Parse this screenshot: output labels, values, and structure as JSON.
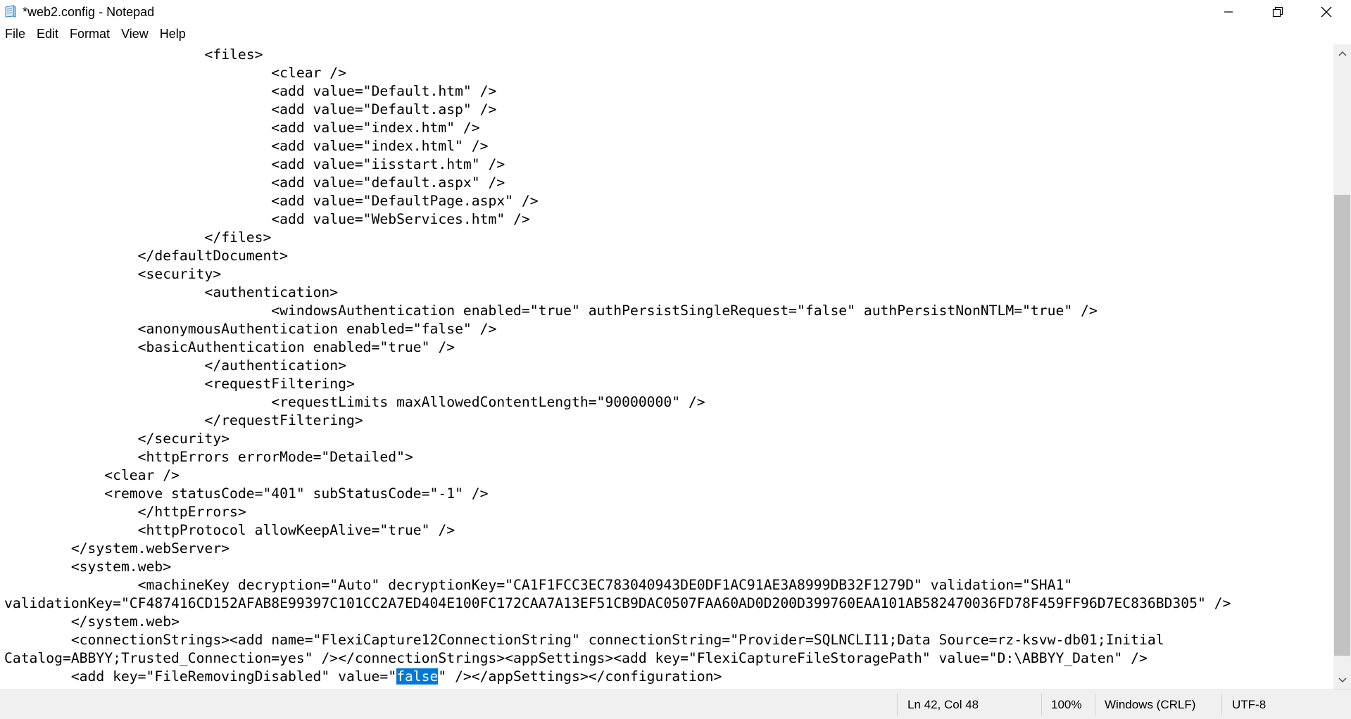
{
  "window": {
    "title": "*web2.config - Notepad"
  },
  "menu": {
    "file": "File",
    "edit": "Edit",
    "format": "Format",
    "view": "View",
    "help": "Help"
  },
  "editor": {
    "lines": [
      "\t\t\t<files>",
      "\t\t\t\t<clear />",
      "\t\t\t\t<add value=\"Default.htm\" />",
      "\t\t\t\t<add value=\"Default.asp\" />",
      "\t\t\t\t<add value=\"index.htm\" />",
      "\t\t\t\t<add value=\"index.html\" />",
      "\t\t\t\t<add value=\"iisstart.htm\" />",
      "\t\t\t\t<add value=\"default.aspx\" />",
      "\t\t\t\t<add value=\"DefaultPage.aspx\" />",
      "\t\t\t\t<add value=\"WebServices.htm\" />",
      "\t\t\t</files>",
      "\t\t</defaultDocument>",
      "\t\t<security>",
      "\t\t\t<authentication>",
      "\t\t\t\t<windowsAuthentication enabled=\"true\" authPersistSingleRequest=\"false\" authPersistNonNTLM=\"true\" />",
      "\t\t<anonymousAuthentication enabled=\"false\" />",
      "\t\t<basicAuthentication enabled=\"true\" />",
      "\t\t\t</authentication>",
      "\t\t\t<requestFiltering>",
      "\t\t\t\t<requestLimits maxAllowedContentLength=\"90000000\" />",
      "\t\t\t</requestFiltering>",
      "\t\t</security>",
      "\t\t<httpErrors errorMode=\"Detailed\">",
      "            <clear />",
      "            <remove statusCode=\"401\" subStatusCode=\"-1\" />",
      "\t\t</httpErrors>",
      "\t\t<httpProtocol allowKeepAlive=\"true\" />",
      "\t</system.webServer>",
      "\t<system.web>",
      "\t\t<machineKey decryption=\"Auto\" decryptionKey=\"CA1F1FCC3EC783040943DE0DF1AC91AE3A8999DB32F1279D\" validation=\"SHA1\"",
      "validationKey=\"CF487416CD152AFAB8E99397C101CC2A7ED404E100FC172CAA7A13EF51CB9DAC0507FAA60AD0D200D399760EAA101AB582470036FD78F459FF96D7EC836BD305\" />",
      "\t</system.web>",
      "\t<connectionStrings><add name=\"FlexiCapture12ConnectionString\" connectionString=\"Provider=SQLNCLI11;Data Source=rz-ksvw-db01;Initial",
      "Catalog=ABBYY;Trusted_Connection=yes\" /></connectionStrings><appSettings><add key=\"FlexiCaptureFileStoragePath\" value=\"D:\\ABBYY_Daten\" />"
    ],
    "last_line_before": "\t<add key=\"FileRemovingDisabled\" value=\"",
    "selected_text": "false",
    "last_line_after": "\" /></appSettings></configuration>"
  },
  "status": {
    "position": "Ln 42, Col 48",
    "zoom": "100%",
    "line_ending": "Windows (CRLF)",
    "encoding": "UTF-8"
  },
  "colors": {
    "selection": "#0078d7",
    "statusbar": "#f0f0f0",
    "scroll_thumb": "#c2c2c2"
  },
  "icons": [
    "notepad-icon",
    "minimize-icon",
    "restore-icon",
    "close-icon",
    "scroll-up-icon",
    "scroll-down-icon"
  ]
}
